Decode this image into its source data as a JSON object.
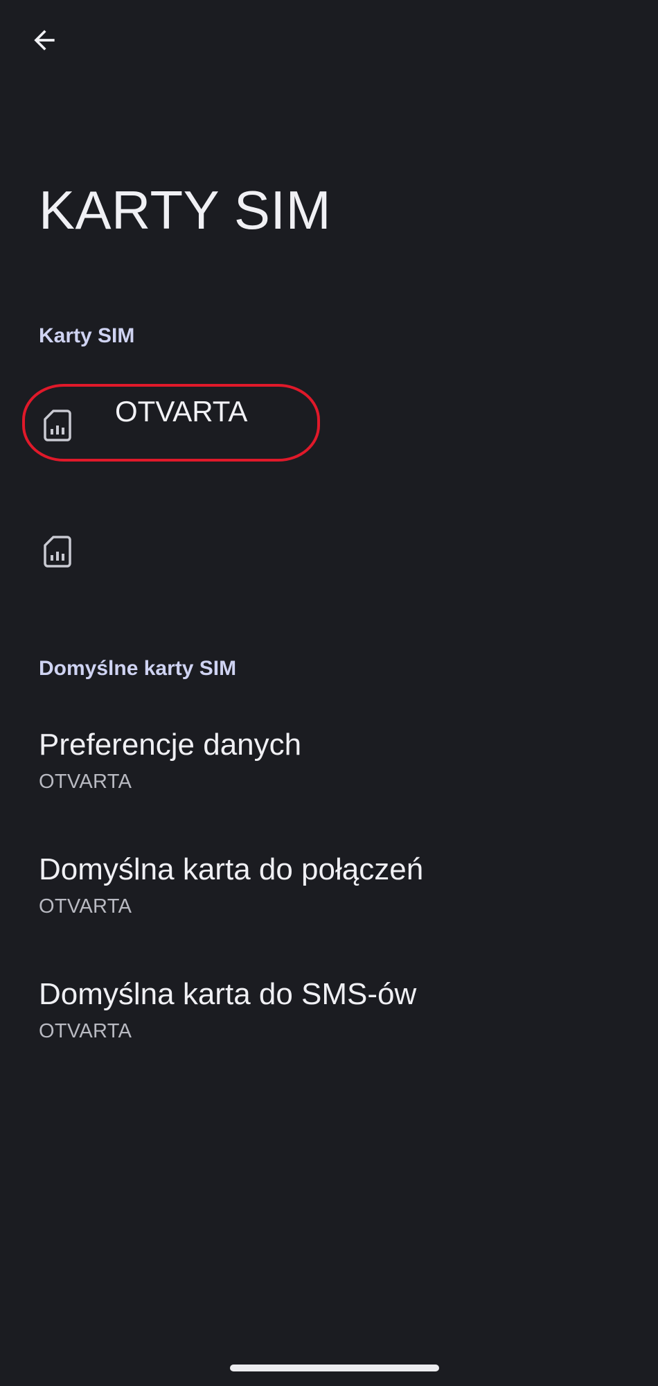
{
  "header": {
    "back_icon": "arrow-left-icon",
    "title": "KARTY SIM"
  },
  "sim_section": {
    "header": "Karty SIM",
    "items": [
      {
        "icon": "sim-card-icon",
        "label": "OTVARTA"
      },
      {
        "icon": "sim-card-icon",
        "label": ""
      }
    ]
  },
  "defaults_section": {
    "header": "Domyślne karty SIM",
    "items": [
      {
        "title": "Preferencje danych",
        "value": "OTVARTA"
      },
      {
        "title": "Domyślna karta do połączeń",
        "value": "OTVARTA"
      },
      {
        "title": "Domyślna karta do SMS-ów",
        "value": "OTVARTA"
      }
    ]
  },
  "colors": {
    "background": "#1b1c21",
    "section_header": "#cfd3f2",
    "annotation": "#e0192a"
  }
}
